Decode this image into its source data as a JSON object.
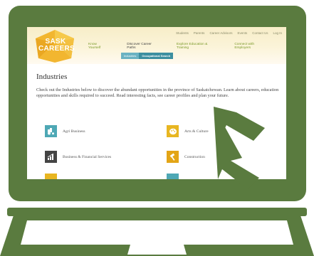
{
  "site": {
    "logo_line1": "SASK",
    "logo_line2": "CAREERS",
    "top_links": [
      "Students",
      "Parents",
      "Career Advisors",
      "Events",
      "Contact Us",
      "Log In"
    ],
    "main_nav": [
      "Know Yourself",
      "Discover Career Paths",
      "Explore Education & Training",
      "Connect with Employers"
    ],
    "sub_tabs": [
      "Industries",
      "Occupational Search"
    ]
  },
  "content": {
    "title": "Industries",
    "intro": "Check out the Industries below to discover the abundant opportunities in the province of Saskatchewan. Learn about careers, education opportunities and skills required to succeed. Read interesting facts, see career profiles and plan your future.",
    "industries": [
      {
        "label": "Agri Business",
        "icon": "tractor-icon"
      },
      {
        "label": "Arts & Culture",
        "icon": "palette-icon"
      },
      {
        "label": "Business & Financial Services",
        "icon": "chart-icon"
      },
      {
        "label": "Construction",
        "icon": "hammer-icon"
      }
    ]
  },
  "colors": {
    "laptop": "#5a7b3f",
    "teal": "#4ea8b5",
    "yellow": "#e8b621",
    "nav_green": "#7a9a2a"
  }
}
